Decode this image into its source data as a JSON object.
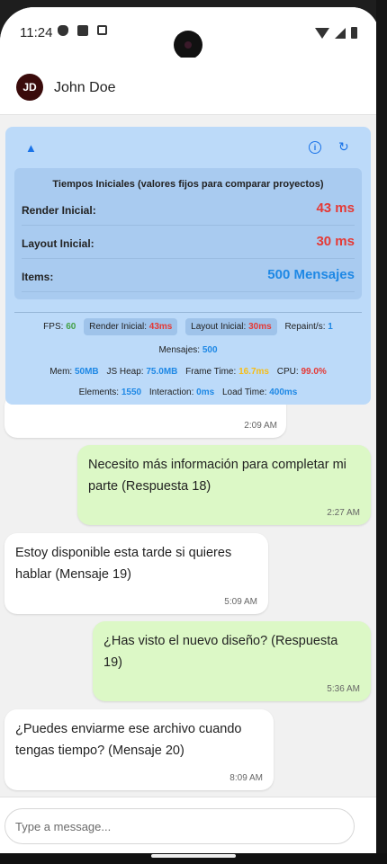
{
  "status_bar": {
    "time": "11:24"
  },
  "header": {
    "avatar_initials": "JD",
    "contact_name": "John Doe"
  },
  "perf_panel": {
    "title": "Tiempos Iniciales (valores fijos para comparar proyectos)",
    "metrics": [
      {
        "label": "Render Inicial:",
        "value": "43 ms",
        "color": "#e53935"
      },
      {
        "label": "Layout Inicial:",
        "value": "30 ms",
        "color": "#e53935"
      },
      {
        "label": "Items:",
        "value": "500 Mensajes",
        "color": "#1e88e5"
      }
    ],
    "stats": {
      "fps_label": "FPS:",
      "fps_value": "60",
      "render_label": "Render Inicial:",
      "render_value": "43ms",
      "layout_label": "Layout Inicial:",
      "layout_value": "30ms",
      "repaint_label": "Repaint/s:",
      "repaint_value": "1",
      "mensajes_label": "Mensajes:",
      "mensajes_value": "500",
      "mem_label": "Mem:",
      "mem_value": "50MB",
      "heap_label": "JS Heap:",
      "heap_value": "75.0MB",
      "frame_label": "Frame Time:",
      "frame_value": "16.7ms",
      "cpu_label": "CPU:",
      "cpu_value": "99.0%",
      "elements_label": "Elements:",
      "elements_value": "1550",
      "interaction_label": "Interaction:",
      "interaction_value": "0ms",
      "load_label": "Load Time:",
      "load_value": "400ms"
    }
  },
  "messages": [
    {
      "direction": "in",
      "text": "",
      "time": "2:09 AM"
    },
    {
      "direction": "out",
      "text": "Necesito más información para completar mi parte (Respuesta 18)",
      "time": "2:27 AM"
    },
    {
      "direction": "in",
      "text": "Estoy disponible esta tarde si quieres hablar (Mensaje 19)",
      "time": "5:09 AM"
    },
    {
      "direction": "out",
      "text": "¿Has visto el nuevo diseño? (Respuesta 19)",
      "time": "5:36 AM"
    },
    {
      "direction": "in",
      "text": "¿Puedes enviarme ese archivo cuando tengas tiempo? (Mensaje 20)",
      "time": "8:09 AM"
    }
  ],
  "composer": {
    "placeholder": "Type a message..."
  }
}
